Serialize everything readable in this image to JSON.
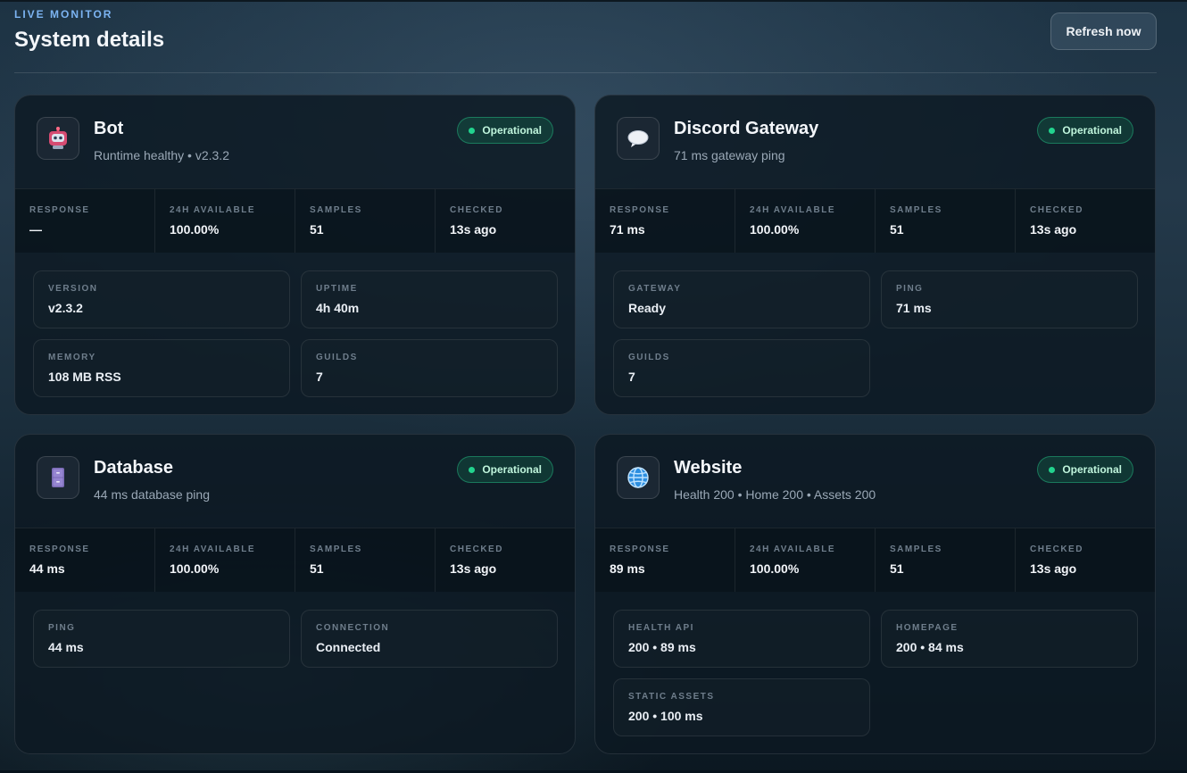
{
  "header": {
    "eyebrow": "LIVE MONITOR",
    "title": "System details",
    "refresh_label": "Refresh now"
  },
  "colors": {
    "accent": "#7cb4f2",
    "status_ok": "#22d38e"
  },
  "cards": [
    {
      "title": "Bot",
      "subtitle": "Runtime healthy • v2.3.2",
      "icon": "robot-icon",
      "status": "Operational",
      "stats": [
        {
          "label": "RESPONSE",
          "value": "—"
        },
        {
          "label": "24H AVAILABLE",
          "value": "100.00%"
        },
        {
          "label": "SAMPLES",
          "value": "51"
        },
        {
          "label": "CHECKED",
          "value": "13s ago"
        }
      ],
      "details": [
        {
          "label": "VERSION",
          "value": "v2.3.2"
        },
        {
          "label": "UPTIME",
          "value": "4h 40m"
        },
        {
          "label": "MEMORY",
          "value": "108 MB RSS"
        },
        {
          "label": "GUILDS",
          "value": "7"
        }
      ]
    },
    {
      "title": "Discord Gateway",
      "subtitle": "71 ms gateway ping",
      "icon": "speech-bubble-icon",
      "status": "Operational",
      "stats": [
        {
          "label": "RESPONSE",
          "value": "71 ms"
        },
        {
          "label": "24H AVAILABLE",
          "value": "100.00%"
        },
        {
          "label": "SAMPLES",
          "value": "51"
        },
        {
          "label": "CHECKED",
          "value": "13s ago"
        }
      ],
      "details": [
        {
          "label": "GATEWAY",
          "value": "Ready"
        },
        {
          "label": "PING",
          "value": "71 ms"
        },
        {
          "label": "GUILDS",
          "value": "7"
        }
      ]
    },
    {
      "title": "Database",
      "subtitle": "44 ms database ping",
      "icon": "file-cabinet-icon",
      "status": "Operational",
      "stats": [
        {
          "label": "RESPONSE",
          "value": "44 ms"
        },
        {
          "label": "24H AVAILABLE",
          "value": "100.00%"
        },
        {
          "label": "SAMPLES",
          "value": "51"
        },
        {
          "label": "CHECKED",
          "value": "13s ago"
        }
      ],
      "details": [
        {
          "label": "PING",
          "value": "44 ms"
        },
        {
          "label": "CONNECTION",
          "value": "Connected"
        }
      ]
    },
    {
      "title": "Website",
      "subtitle": "Health 200 • Home 200 • Assets 200",
      "icon": "globe-icon",
      "status": "Operational",
      "stats": [
        {
          "label": "RESPONSE",
          "value": "89 ms"
        },
        {
          "label": "24H AVAILABLE",
          "value": "100.00%"
        },
        {
          "label": "SAMPLES",
          "value": "51"
        },
        {
          "label": "CHECKED",
          "value": "13s ago"
        }
      ],
      "details": [
        {
          "label": "HEALTH API",
          "value": "200 • 89 ms"
        },
        {
          "label": "HOMEPAGE",
          "value": "200 • 84 ms"
        },
        {
          "label": "STATIC ASSETS",
          "value": "200 • 100 ms"
        }
      ]
    }
  ]
}
